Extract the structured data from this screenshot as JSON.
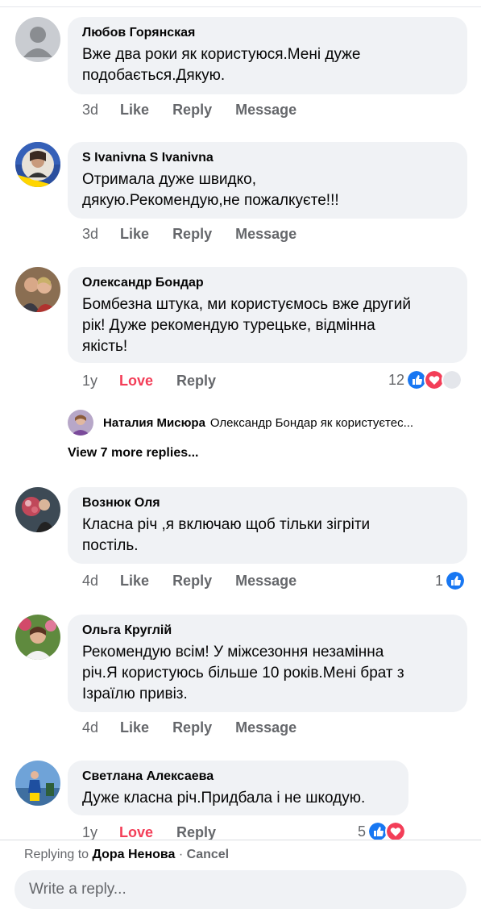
{
  "comments": [
    {
      "author": "Любов Горянская",
      "text": "Вже два роки як користуюся.Мені дуже\nподобається.Дякую.",
      "time": "3d",
      "action1": "Like",
      "action2": "Reply",
      "action3": "Message"
    },
    {
      "author": "S Ivanivna S Ivanivna",
      "text": "Отримала дуже швидко,\nдякую.Рекомендую,не пожалкуєте!!!",
      "time": "3d",
      "action1": "Like",
      "action2": "Reply",
      "action3": "Message"
    },
    {
      "author": "Олександр Бондар",
      "text": "Бомбезна штука, ми користуємось вже другий\nрік! Дуже рекомендую турецьке, відмінна\nякість!",
      "time": "1y",
      "action1": "Love",
      "action2": "Reply",
      "reactions": "12"
    },
    {
      "author": "Вознюк Оля",
      "text": "Класна річ ,я включаю щоб тільки зігріти\nпостіль.",
      "time": "4d",
      "action1": "Like",
      "action2": "Reply",
      "action3": "Message",
      "reactions": "1"
    },
    {
      "author": "Ольга Круглій",
      "text": "Рекомендую всім! У міжсезоння незамінна\nріч.Я користуюсь більше 10 років.Мені брат з\nІзраїлю привіз.",
      "time": "4d",
      "action1": "Like",
      "action2": "Reply",
      "action3": "Message"
    },
    {
      "author": "Светлана Алексаева",
      "text": "Дуже класна річ.Придбала і не шкодую.",
      "time": "1y",
      "action1": "Love",
      "action2": "Reply",
      "reactions": "5"
    }
  ],
  "reply_preview": {
    "author": "Наталия Мисюра",
    "text": "Олександр Бондар  як користуєтес..."
  },
  "view_more": "View 7 more replies...",
  "footer": {
    "replying_prefix": "Replying to",
    "replying_name": "Дора Ненова",
    "separator": "·",
    "cancel": "Cancel",
    "placeholder": "Write a reply..."
  },
  "colors": {
    "bubble": "#f0f2f5",
    "muted": "#65676b",
    "love": "#f33e58",
    "like_blue": "#1877f2"
  }
}
